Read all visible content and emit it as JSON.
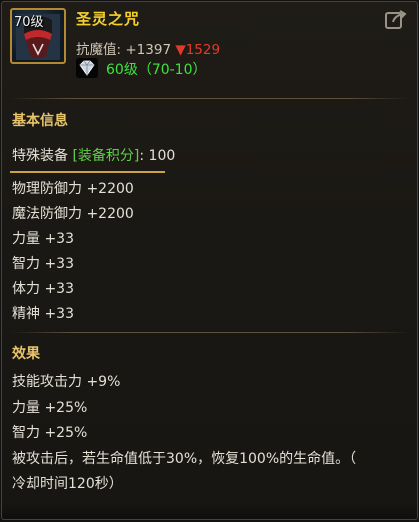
{
  "item": {
    "level_badge": "70级",
    "name": "圣灵之咒",
    "resist_label": "抗魔值:",
    "resist_value": "+1397",
    "resist_delta": "▼1529",
    "gem_text": "60级（70-10）",
    "icon": "mask-icon",
    "corner_icon": "share-icon"
  },
  "basic": {
    "title": "基本信息",
    "special_label": "特殊装备",
    "score_tag": "[装备积分]",
    "score_value": ": 100",
    "stats": [
      "物理防御力 +2200",
      "魔法防御力 +2200",
      "力量 +33",
      "智力 +33",
      "体力 +33",
      "精神 +33"
    ]
  },
  "effects": {
    "title": "效果",
    "lines": [
      "技能攻击力 +9%",
      "力量 +25%",
      "智力 +25%",
      "被攻击后，若生命值低于30%，恢复100%的生命值。（",
      "冷却时间120秒）"
    ]
  },
  "colors": {
    "name": "#f6d12a",
    "section_title": "#e8c46a",
    "tag": "#5fd04a",
    "delta_down": "#e23a2a",
    "gem_text": "#3fe23f"
  }
}
